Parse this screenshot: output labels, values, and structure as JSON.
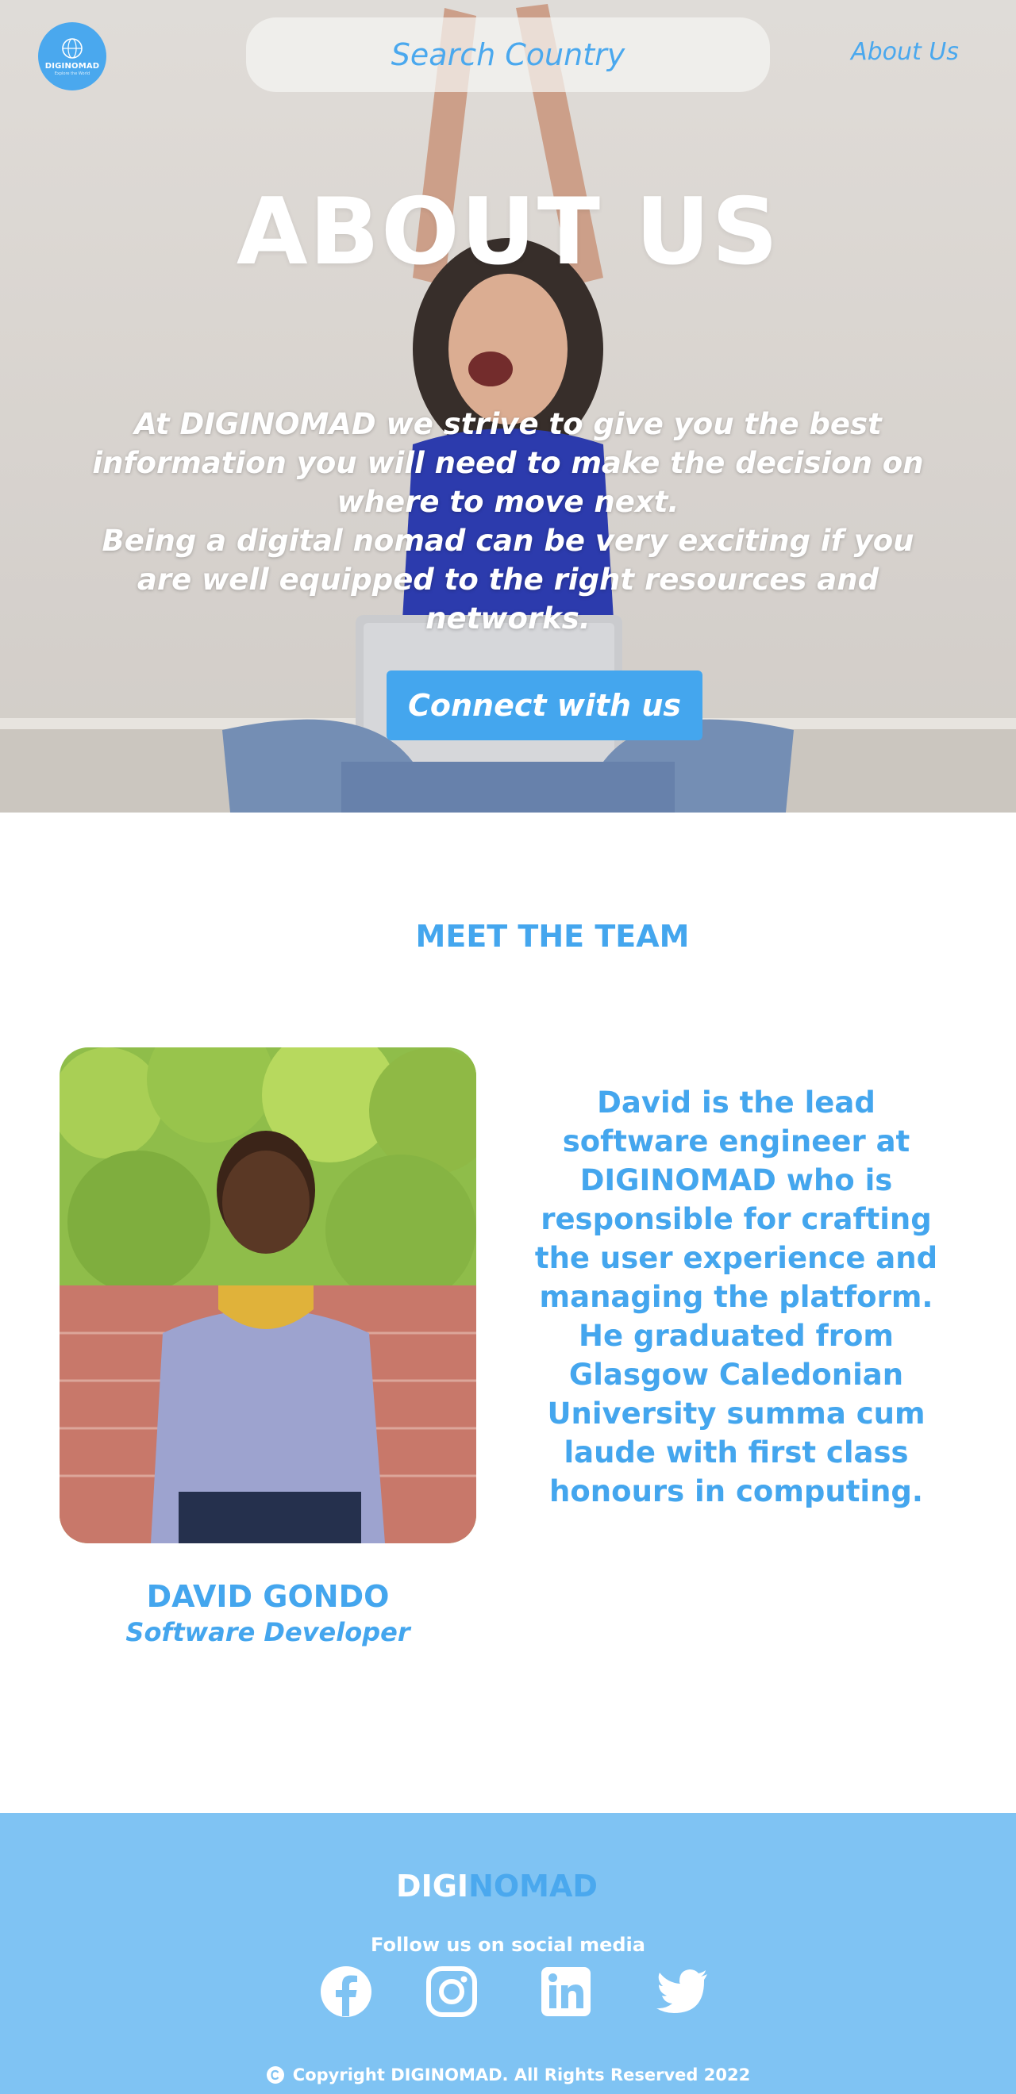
{
  "header": {
    "logo_text": "DIGINOMAD",
    "logo_sub": "Explore the World",
    "search_placeholder": "Search Country",
    "nav_about": "About Us"
  },
  "hero": {
    "title": "ABOUT US",
    "paragraph_1": "At DIGINOMAD we strive to give you the best information you will need to make the decision on where to move next.",
    "paragraph_2": "Being a digital nomad can be very exciting if you are well equipped to the right resources and networks.",
    "cta_label": "Connect with us"
  },
  "team": {
    "heading": "MEET THE TEAM",
    "members": [
      {
        "name": "DAVID GONDO",
        "role": "Software Developer",
        "bio": "David is the lead software engineer at DIGINOMAD who is responsible for crafting the user experience and managing the platform. He graduated from Glasgow Caledonian University summa cum laude with first class honours in computing."
      }
    ]
  },
  "footer": {
    "brand_part_1": "DIGI",
    "brand_part_2": "NOMAD",
    "follow_text": "Follow us on social media",
    "social": [
      "facebook-icon",
      "instagram-icon",
      "linkedin-icon",
      "twitter-icon"
    ],
    "copyright": "Copyright DIGINOMAD. All Rights Reserved 2022"
  },
  "colors": {
    "accent": "#44a6ee",
    "footer_bg": "#7fc3f3",
    "white": "#ffffff"
  }
}
